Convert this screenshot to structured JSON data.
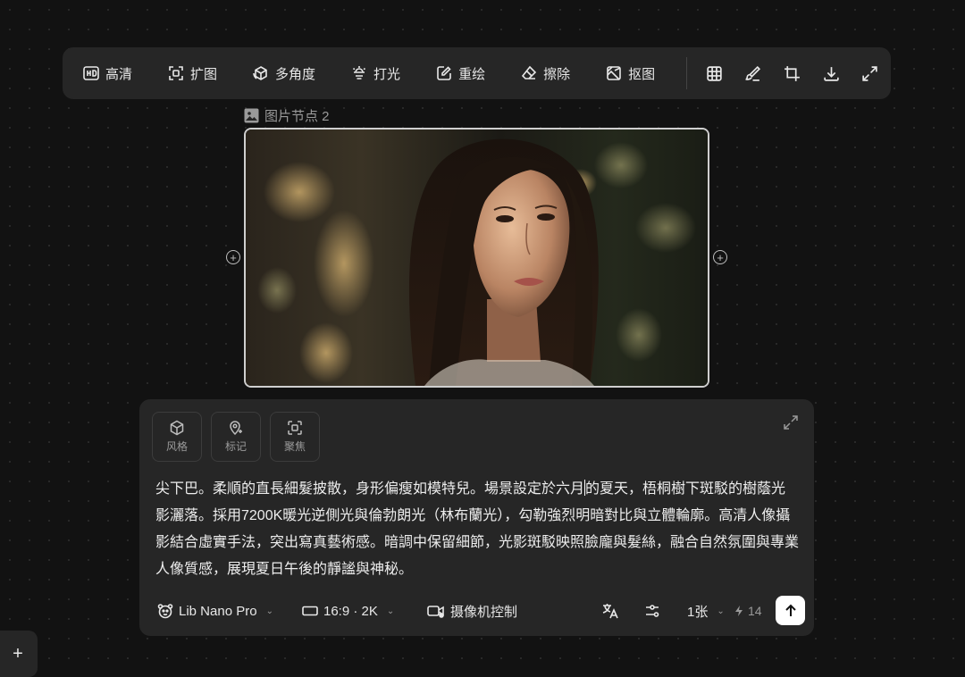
{
  "toolbar": {
    "items": [
      {
        "label": "高清",
        "icon": "hd-icon"
      },
      {
        "label": "扩图",
        "icon": "expand-image-icon"
      },
      {
        "label": "多角度",
        "icon": "multi-angle-icon"
      },
      {
        "label": "打光",
        "icon": "lighting-icon"
      },
      {
        "label": "重绘",
        "icon": "redraw-icon"
      },
      {
        "label": "擦除",
        "icon": "eraser-icon"
      },
      {
        "label": "抠图",
        "icon": "cutout-icon"
      }
    ],
    "icon_buttons": [
      "grid-icon",
      "brush-icon",
      "crop-icon",
      "download-icon",
      "fullscreen-icon"
    ]
  },
  "node": {
    "label": "图片节点 2",
    "icon": "image-icon"
  },
  "panel": {
    "chips": [
      {
        "label": "风格",
        "icon": "cube-icon"
      },
      {
        "label": "标记",
        "icon": "marker-pin-icon"
      },
      {
        "label": "聚焦",
        "icon": "focus-icon"
      }
    ],
    "prompt_before_caret": "尖下巴。柔順的直長細髮披散，身形偏瘦如模特兒。場景設定於六月",
    "prompt_after_caret": "的夏天，梧桐樹下斑駁的樹蔭光影灑落。採用7200K暖光逆側光與倫勃朗光（林布蘭光），勾勒強烈明暗對比與立體輪廓。高清人像攝影結合虛實手法，突出寫真藝術感。暗調中保留細節，光影斑駁映照臉龐與髮絲，融合自然氛圍與專業人像質感，展現夏日午後的靜謐與神秘。",
    "model": "Lib Nano Pro",
    "ratio": "16:9 · 2K",
    "camera_control": "摄像机控制",
    "count": "1张",
    "credits": "14"
  },
  "colors": {
    "background": "#121212",
    "surface": "#262626",
    "text": "#e8e8e8",
    "muted": "#9a9a9a"
  }
}
